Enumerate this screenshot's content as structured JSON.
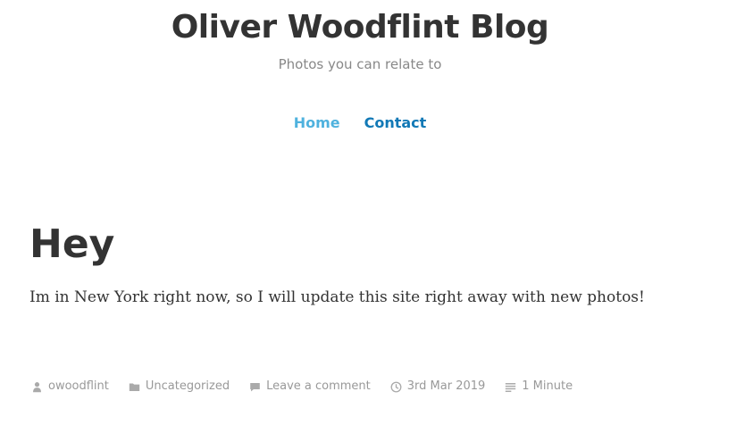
{
  "site": {
    "title": "Oliver Woodflint Blog",
    "description": "Photos you can relate to"
  },
  "nav": {
    "items": [
      {
        "label": "Home",
        "current": true
      },
      {
        "label": "Contact",
        "current": false
      }
    ]
  },
  "post": {
    "title": "Hey",
    "content": "Im in New York right now, so I will update this site right away with new photos!",
    "meta": {
      "author": "owoodflint",
      "author_icon": "user-icon",
      "category": "Uncategorized",
      "category_icon": "folder-icon",
      "comments": "Leave a comment",
      "comments_icon": "comment-icon",
      "date": "3rd Mar 2019",
      "date_icon": "clock-icon",
      "reading_time": "1 Minute",
      "reading_time_icon": "lines-icon"
    }
  },
  "colors": {
    "text": "#333333",
    "muted": "#999999",
    "nav_current": "#4fb2de",
    "nav_link": "#1279b6"
  }
}
